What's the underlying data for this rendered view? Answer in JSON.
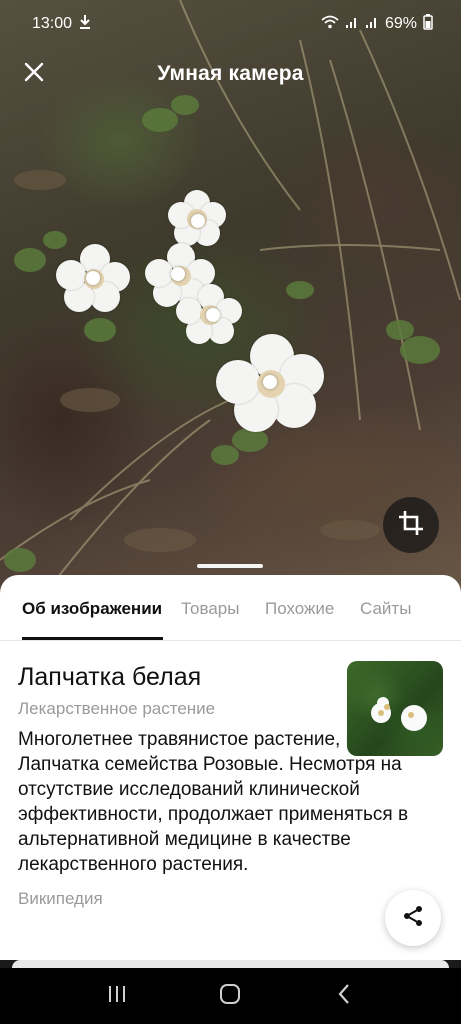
{
  "status_bar": {
    "time": "13:00",
    "battery": "69%",
    "icons": [
      "download-icon",
      "wifi-icon",
      "signal-icon",
      "signal-icon",
      "battery-icon"
    ]
  },
  "header": {
    "title": "Умная камера",
    "close_icon": "close-icon"
  },
  "photo": {
    "crop_icon": "crop-icon"
  },
  "tabs": [
    {
      "label": "Об изображении",
      "active": true
    },
    {
      "label": "Товары",
      "active": false
    },
    {
      "label": "Похожие",
      "active": false
    },
    {
      "label": "Сайты",
      "active": false
    }
  ],
  "result": {
    "title": "Лапчатка белая",
    "subtitle": "Лекарственное растение",
    "description": "Многолетнее травянистое растение, вид рода Лапчатка семейства Розовые. Несмотря на отсутствие исследований клинической эффективности, продолжает применяться в альтернативной медицине в качестве лекарственного растения.",
    "source": "Википедия",
    "share_icon": "share-icon"
  },
  "nav_bar": {
    "icons": [
      "recent-apps-icon",
      "home-icon",
      "back-icon"
    ]
  },
  "colors": {
    "sheet_bg": "#ffffff",
    "text_primary": "#111111",
    "text_secondary": "#9a9a9a"
  }
}
